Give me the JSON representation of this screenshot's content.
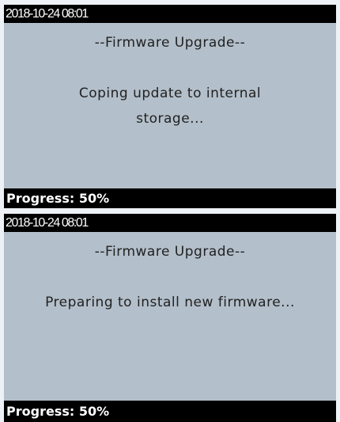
{
  "screens": [
    {
      "datetime": "2018-10-24 08:01",
      "heading": "--Firmware Upgrade--",
      "message": "Coping update to internal storage...",
      "progress_label": "Progress:",
      "progress_value": "50%",
      "progress_text": "Progress: 50%",
      "progress_fraction": 0.5
    },
    {
      "datetime": "2018-10-24 08:01",
      "heading": "--Firmware Upgrade--",
      "message": "Preparing to install new firmware...",
      "progress_label": "Progress:",
      "progress_value": "50%",
      "progress_text": "Progress: 50%",
      "progress_fraction": 0.5
    }
  ],
  "colors": {
    "screen_background": "#b3bfca",
    "bar_background": "#000000",
    "bar_text": "#ffffff",
    "body_text": "#222222"
  }
}
